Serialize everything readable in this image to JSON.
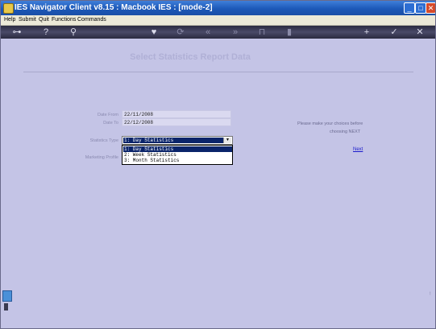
{
  "window": {
    "title": "IES Navigator Client v8.15 : Macbook IES :      [mode-2]",
    "controls": {
      "minimize": "_",
      "maximize": "□",
      "close": "✕"
    }
  },
  "menubar": {
    "items": [
      "Help",
      "Submit",
      "Quit",
      "Functions",
      "Commands"
    ]
  },
  "toolbar": {
    "icons": [
      "key-icon",
      "help-icon",
      "search-icon",
      "heart-icon",
      "refresh-icon",
      "back-icon",
      "forward-icon",
      "nav-icon",
      "bookmark-icon",
      "add-icon",
      "check-icon",
      "close-icon"
    ],
    "glyphs": {
      "key": "⊶",
      "help": "?",
      "search": "⚲",
      "heart": "♥",
      "refresh": "⟳",
      "back": "«",
      "forward": "»",
      "nav": "⊓",
      "bookmark": "▮",
      "add": "+",
      "check": "✓",
      "close": "✕"
    }
  },
  "page": {
    "title": "Select Statistics Report Data"
  },
  "form": {
    "date_from": {
      "label": "Date From",
      "value": "22/11/2008"
    },
    "date_to": {
      "label": "Date To",
      "value": "22/12/2008"
    },
    "statistics_type": {
      "label": "Statistics Type",
      "selected": "1: Day Statistics",
      "options": [
        "1: Day Statistics",
        "2: Week Statistics",
        "3: Month Statistics"
      ]
    },
    "marketing_profile": {
      "label": "Marketing Profile"
    }
  },
  "help": {
    "message_line1": "Please make your choices before",
    "message_line2": "choosing NEXT",
    "next_link": "Next"
  },
  "colors": {
    "background": "#c4c4e6",
    "titlebar": "#1c58b8",
    "selection": "#0a246a",
    "link": "#1a1acc"
  }
}
